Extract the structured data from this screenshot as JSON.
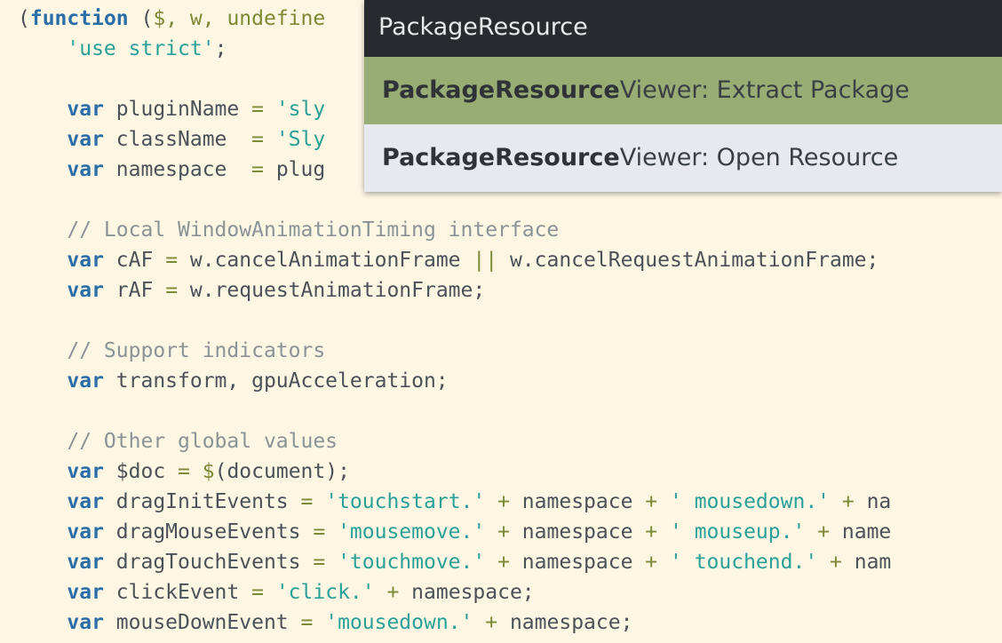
{
  "palette": {
    "query": "PackageResource",
    "items": [
      {
        "match": "PackageResource",
        "rest": "Viewer: Extract Package",
        "selected": true
      },
      {
        "match": "PackageResource",
        "rest": "Viewer: Open Resource",
        "selected": false
      }
    ]
  },
  "colors": {
    "editor_bg": "#fdf6e3",
    "keyword": "#2a6ea8",
    "string": "#2aa198",
    "comment": "#8a9396",
    "palette_input_bg": "#272b30",
    "palette_selected_bg": "#97ad74",
    "palette_list_bg": "#e7e9ee"
  },
  "code": {
    "lines": [
      [
        {
          "t": "(",
          "c": "id"
        },
        {
          "t": "function",
          "c": "kw"
        },
        {
          "t": " (",
          "c": "id"
        },
        {
          "t": "$",
          "c": "op"
        },
        {
          "t": ", w, undefine",
          "c": "op"
        }
      ],
      [
        {
          "t": "    ",
          "c": "id"
        },
        {
          "t": "'use strict'",
          "c": "str"
        },
        {
          "t": ";",
          "c": "id"
        }
      ],
      [],
      [
        {
          "t": "    ",
          "c": "id"
        },
        {
          "t": "var",
          "c": "kw"
        },
        {
          "t": " pluginName ",
          "c": "id"
        },
        {
          "t": "=",
          "c": "op"
        },
        {
          "t": " ",
          "c": "id"
        },
        {
          "t": "'sly",
          "c": "str"
        }
      ],
      [
        {
          "t": "    ",
          "c": "id"
        },
        {
          "t": "var",
          "c": "kw"
        },
        {
          "t": " className  ",
          "c": "id"
        },
        {
          "t": "=",
          "c": "op"
        },
        {
          "t": " ",
          "c": "id"
        },
        {
          "t": "'Sly",
          "c": "str"
        }
      ],
      [
        {
          "t": "    ",
          "c": "id"
        },
        {
          "t": "var",
          "c": "kw"
        },
        {
          "t": " namespace  ",
          "c": "id"
        },
        {
          "t": "=",
          "c": "op"
        },
        {
          "t": " plug",
          "c": "id"
        }
      ],
      [],
      [
        {
          "t": "    // Local WindowAnimationTiming interface",
          "c": "cmt"
        }
      ],
      [
        {
          "t": "    ",
          "c": "id"
        },
        {
          "t": "var",
          "c": "kw"
        },
        {
          "t": " cAF ",
          "c": "id"
        },
        {
          "t": "=",
          "c": "op"
        },
        {
          "t": " w.cancelAnimationFrame ",
          "c": "id"
        },
        {
          "t": "||",
          "c": "op"
        },
        {
          "t": " w.cancelRequestAnimationFrame;",
          "c": "id"
        }
      ],
      [
        {
          "t": "    ",
          "c": "id"
        },
        {
          "t": "var",
          "c": "kw"
        },
        {
          "t": " rAF ",
          "c": "id"
        },
        {
          "t": "=",
          "c": "op"
        },
        {
          "t": " w.requestAnimationFrame;",
          "c": "id"
        }
      ],
      [],
      [
        {
          "t": "    // Support indicators",
          "c": "cmt"
        }
      ],
      [
        {
          "t": "    ",
          "c": "id"
        },
        {
          "t": "var",
          "c": "kw"
        },
        {
          "t": " transform, gpuAcceleration;",
          "c": "id"
        }
      ],
      [],
      [
        {
          "t": "    // Other global values",
          "c": "cmt"
        }
      ],
      [
        {
          "t": "    ",
          "c": "id"
        },
        {
          "t": "var",
          "c": "kw"
        },
        {
          "t": " $doc ",
          "c": "id"
        },
        {
          "t": "=",
          "c": "op"
        },
        {
          "t": " ",
          "c": "id"
        },
        {
          "t": "$",
          "c": "op"
        },
        {
          "t": "(document);",
          "c": "id"
        }
      ],
      [
        {
          "t": "    ",
          "c": "id"
        },
        {
          "t": "var",
          "c": "kw"
        },
        {
          "t": " dragInitEvents ",
          "c": "id"
        },
        {
          "t": "=",
          "c": "op"
        },
        {
          "t": " ",
          "c": "id"
        },
        {
          "t": "'touchstart.'",
          "c": "str"
        },
        {
          "t": " ",
          "c": "id"
        },
        {
          "t": "+",
          "c": "op"
        },
        {
          "t": " namespace ",
          "c": "id"
        },
        {
          "t": "+",
          "c": "op"
        },
        {
          "t": " ",
          "c": "id"
        },
        {
          "t": "' mousedown.'",
          "c": "str"
        },
        {
          "t": " ",
          "c": "id"
        },
        {
          "t": "+",
          "c": "op"
        },
        {
          "t": " na",
          "c": "id"
        }
      ],
      [
        {
          "t": "    ",
          "c": "id"
        },
        {
          "t": "var",
          "c": "kw"
        },
        {
          "t": " dragMouseEvents ",
          "c": "id"
        },
        {
          "t": "=",
          "c": "op"
        },
        {
          "t": " ",
          "c": "id"
        },
        {
          "t": "'mousemove.'",
          "c": "str"
        },
        {
          "t": " ",
          "c": "id"
        },
        {
          "t": "+",
          "c": "op"
        },
        {
          "t": " namespace ",
          "c": "id"
        },
        {
          "t": "+",
          "c": "op"
        },
        {
          "t": " ",
          "c": "id"
        },
        {
          "t": "' mouseup.'",
          "c": "str"
        },
        {
          "t": " ",
          "c": "id"
        },
        {
          "t": "+",
          "c": "op"
        },
        {
          "t": " name",
          "c": "id"
        }
      ],
      [
        {
          "t": "    ",
          "c": "id"
        },
        {
          "t": "var",
          "c": "kw"
        },
        {
          "t": " dragTouchEvents ",
          "c": "id"
        },
        {
          "t": "=",
          "c": "op"
        },
        {
          "t": " ",
          "c": "id"
        },
        {
          "t": "'touchmove.'",
          "c": "str"
        },
        {
          "t": " ",
          "c": "id"
        },
        {
          "t": "+",
          "c": "op"
        },
        {
          "t": " namespace ",
          "c": "id"
        },
        {
          "t": "+",
          "c": "op"
        },
        {
          "t": " ",
          "c": "id"
        },
        {
          "t": "' touchend.'",
          "c": "str"
        },
        {
          "t": " ",
          "c": "id"
        },
        {
          "t": "+",
          "c": "op"
        },
        {
          "t": " nam",
          "c": "id"
        }
      ],
      [
        {
          "t": "    ",
          "c": "id"
        },
        {
          "t": "var",
          "c": "kw"
        },
        {
          "t": " clickEvent ",
          "c": "id"
        },
        {
          "t": "=",
          "c": "op"
        },
        {
          "t": " ",
          "c": "id"
        },
        {
          "t": "'click.'",
          "c": "str"
        },
        {
          "t": " ",
          "c": "id"
        },
        {
          "t": "+",
          "c": "op"
        },
        {
          "t": " namespace;",
          "c": "id"
        }
      ],
      [
        {
          "t": "    ",
          "c": "id"
        },
        {
          "t": "var",
          "c": "kw"
        },
        {
          "t": " mouseDownEvent ",
          "c": "id"
        },
        {
          "t": "=",
          "c": "op"
        },
        {
          "t": " ",
          "c": "id"
        },
        {
          "t": "'mousedown.'",
          "c": "str"
        },
        {
          "t": " ",
          "c": "id"
        },
        {
          "t": "+",
          "c": "op"
        },
        {
          "t": " namespace;",
          "c": "id"
        }
      ]
    ]
  }
}
